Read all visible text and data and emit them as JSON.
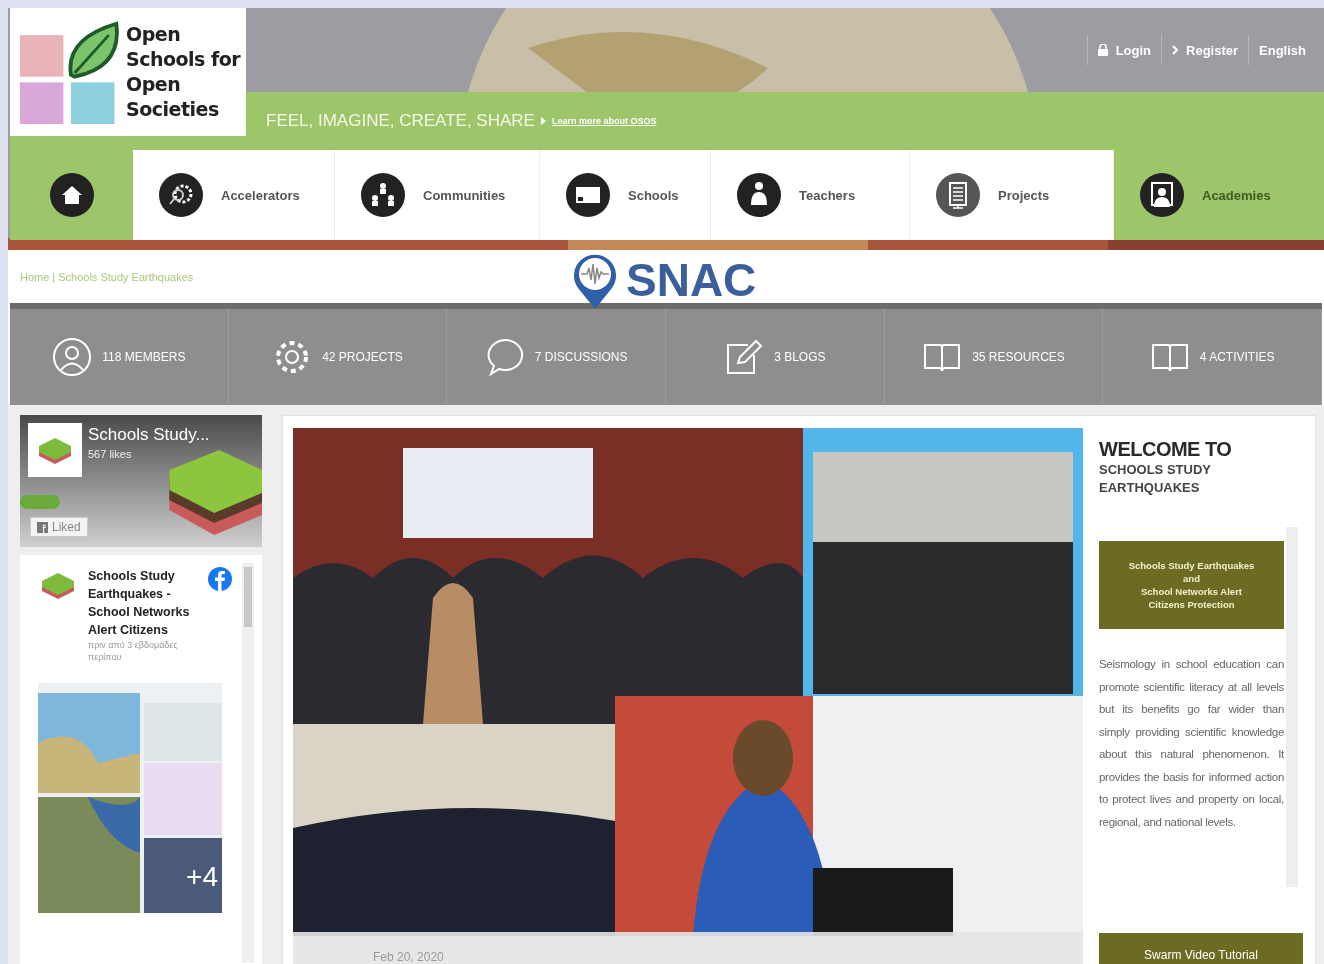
{
  "logo": {
    "lines": [
      "Open",
      "Schools for",
      "Open",
      "Societies"
    ]
  },
  "top_links": [
    {
      "kind": "login",
      "label": "Login"
    },
    {
      "kind": "register",
      "label": "Register"
    },
    {
      "kind": "language",
      "label": "English"
    }
  ],
  "tagline": "FEEL, IMAGINE, CREATE, SHARE",
  "tagline_link": "Learn more about OSOS",
  "nav": [
    {
      "kind": "home",
      "selected": true
    },
    {
      "kind": "gear",
      "label": "Accelerators",
      "selected": false
    },
    {
      "kind": "people",
      "label": "Communities",
      "selected": false
    },
    {
      "kind": "board",
      "label": "Schools",
      "selected": false
    },
    {
      "kind": "person",
      "label": "Teachers",
      "selected": false
    },
    {
      "kind": "list",
      "label": "Projects",
      "selected": false
    },
    {
      "kind": "frame",
      "label": "Academies",
      "selected": true
    }
  ],
  "breadcrumb": {
    "items": [
      "Home",
      "Schools Study Earthquakes"
    ],
    "separator": "|"
  },
  "brand": "SNAC",
  "stats": [
    {
      "kind": "user",
      "label": "118 MEMBERS"
    },
    {
      "kind": "gear",
      "label": "42 PROJECTS"
    },
    {
      "kind": "chat",
      "label": "7 DISCUSSIONS"
    },
    {
      "kind": "edit",
      "label": "3 BLOGS"
    },
    {
      "kind": "book",
      "label": "35 RESOURCES"
    },
    {
      "kind": "book",
      "label": "4 ACTIVITIES"
    }
  ],
  "facebook": {
    "page_name": "Schools Study...",
    "likes": "567 likes",
    "like_button": "Liked",
    "post_title": "Schools Study Earthquakes - School Networks Alert Citizens",
    "post_time": "πριν από 3 εβδομάδες περίπου",
    "more_photos": "+4"
  },
  "gallery": {
    "date": "Feb 20, 2020"
  },
  "welcome": {
    "title": "WELCOME TO",
    "subtitle": "SCHOOLS STUDY EARTHQUAKES",
    "banner_lines": [
      "Schools Study Earthquakes",
      "and",
      "School Networks Alert",
      "Citizens Protection"
    ],
    "body": "Seismology in school education can promote scientific literacy at all levels but its benefits go far wider than simply providing scientific knowledge about this natural phenomenon. It provides the basis for informed action to protect lives and property on local, regional, and national levels.",
    "button": "Swarm Video Tutorial"
  }
}
